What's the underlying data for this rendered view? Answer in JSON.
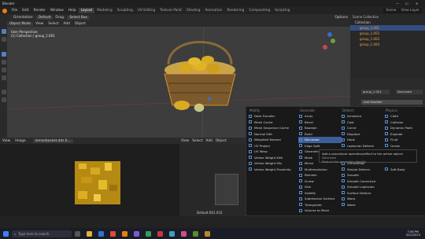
{
  "app": {
    "title": "Blender",
    "scene": "Scene",
    "view_layer": "View Layer"
  },
  "menubar": {
    "menus": [
      "File",
      "Edit",
      "Render",
      "Window",
      "Help"
    ],
    "workspaces": [
      "Layout",
      "Modeling",
      "Sculpting",
      "UV Editing",
      "Texture Paint",
      "Shading",
      "Animation",
      "Rendering",
      "Compositing",
      "Scripting"
    ],
    "active_workspace": "Layout"
  },
  "viewport_header": {
    "mode": "Object Mode",
    "items": [
      "View",
      "Select",
      "Add",
      "Object"
    ],
    "orientation": "Orientation:",
    "orientation_value": "Default",
    "drag": "Drag:",
    "drag_value": "Select Box",
    "options": "Options"
  },
  "viewport_info": {
    "line1": "User Perspective",
    "line2": "(1) Collection | group_1.001"
  },
  "outliner": {
    "rows": [
      "Scene Collection",
      "Collection",
      "group_1.001",
      "group_1.002",
      "group_1.003",
      "group_1.004"
    ],
    "selected_row": "group_1.001"
  },
  "properties": {
    "object": "group_1.001",
    "modifier_tab": "Decimate",
    "add_modifier": "Add Modifier"
  },
  "image_editor": {
    "items": [
      "View",
      "Image"
    ],
    "image_name": "lemonbasket.dds.0..."
  },
  "node_editor": {
    "items": [
      "View",
      "Select",
      "Add",
      "Object"
    ],
    "label": "Default.001.010"
  },
  "modifier_menu": {
    "columns": [
      {
        "header": "Modify",
        "items": [
          "Data Transfer",
          "Mesh Cache",
          "Mesh Sequence Cache",
          "Normal Edit",
          "Weighted Normal",
          "UV Project",
          "UV Warp",
          "Vertex Weight Edit",
          "Vertex Weight Mix",
          "Vertex Weight Proximity"
        ]
      },
      {
        "header": "Generate",
        "items": [
          "Array",
          "Bevel",
          "Boolean",
          "Build",
          "Decimate",
          "Edge Split",
          "Geometry",
          "Mask",
          "Mirror",
          "Multiresolution",
          "Remesh",
          "Screw",
          "Skin",
          "Solidify",
          "Subdivision Surface",
          "Triangulate",
          "Volume to Mesh"
        ]
      },
      {
        "header": "Deform",
        "items": [
          "Armature",
          "Cast",
          "Curve",
          "Displace",
          "Hook",
          "Laplacian Deform",
          "Lattice",
          "Mesh Deform",
          "Shrinkwrap",
          "Simple Deform",
          "Smooth",
          "Smooth Corrective",
          "Smooth Laplacian",
          "Surface Deform",
          "Warp",
          "Wave"
        ]
      },
      {
        "header": "Physics",
        "items": [
          "Cloth",
          "Collision",
          "Dynamic Paint",
          "Explode",
          "Fluid",
          "Ocean",
          "Particle Instance",
          "Particle System",
          "Soft Body"
        ]
      }
    ],
    "highlighted": "Decimate"
  },
  "tooltip": {
    "line1": "Add a procedural operation/effect to the active object:",
    "line1_value": "Decimate",
    "line2": "Reduce the geometry density"
  },
  "taskbar": {
    "search_placeholder": "Type here to search",
    "time": "7:56 PM",
    "date": "5/22/2023"
  }
}
